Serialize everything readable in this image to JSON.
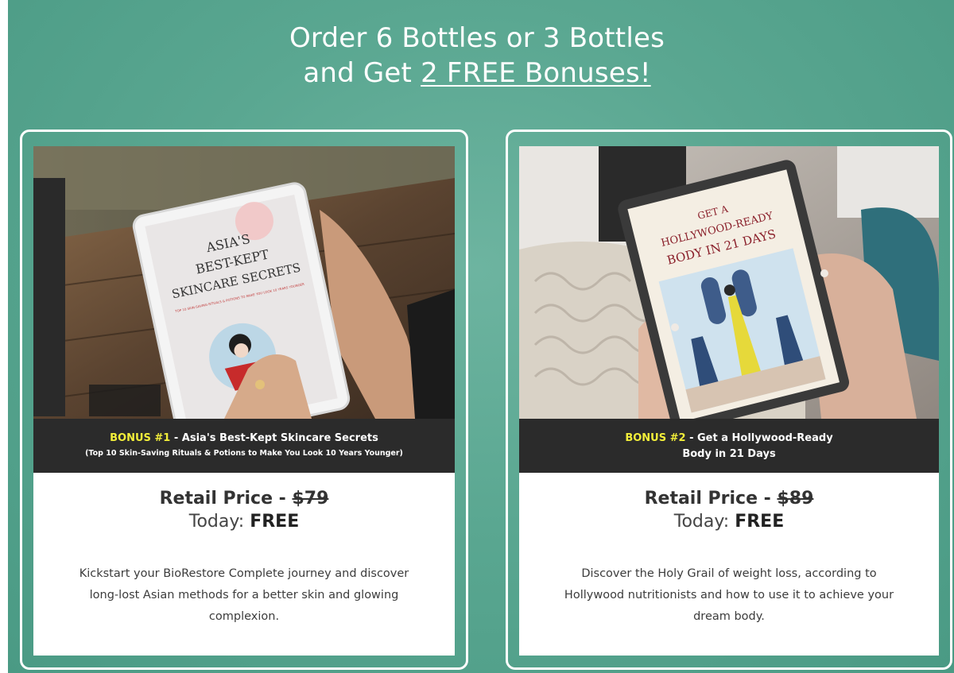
{
  "headline": {
    "line1": "Order 6 Bottles or 3 Bottles",
    "line2_prefix": "and Get ",
    "line2_link": "2 FREE Bonuses!"
  },
  "bonuses": [
    {
      "tag": "BONUS #1",
      "title": " - Asia's Best-Kept Skincare Secrets",
      "subtitle": "(Top 10 Skin-Saving Rituals & Potions to Make You Look 10 Years Younger)",
      "ebook_title_lines": [
        "ASIA'S",
        "BEST-KEPT",
        "SKINCARE SECRETS"
      ],
      "ebook_tagline": "TOP 10 SKIN-SAVING RITUALS & POTIONS TO MAKE YOU LOOK 10 YEARS YOUNGER",
      "retail_label": "Retail Price - ",
      "retail_price": "$79",
      "today_label": "Today: ",
      "today_value": "FREE",
      "description": "Kickstart your BioRestore Complete journey and discover long-lost Asian methods for a better skin and glowing complexion."
    },
    {
      "tag": "BONUS #2",
      "title": " - Get a Hollywood-Ready",
      "title_line2": "Body in 21 Days",
      "ebook_title_lines": [
        "GET A",
        "HOLLYWOOD-READY",
        "BODY IN 21 DAYS"
      ],
      "retail_label": "Retail Price - ",
      "retail_price": "$89",
      "today_label": "Today: ",
      "today_value": "FREE",
      "description": "Discover the Holy Grail of weight loss, according to Hollywood nutritionists and how to use it to achieve your dream body."
    }
  ],
  "colors": {
    "background": "#5aa791",
    "card_border": "#ffffff",
    "caption_bg": "#2b2b2b",
    "bonus_tag": "#f2ee3a"
  }
}
